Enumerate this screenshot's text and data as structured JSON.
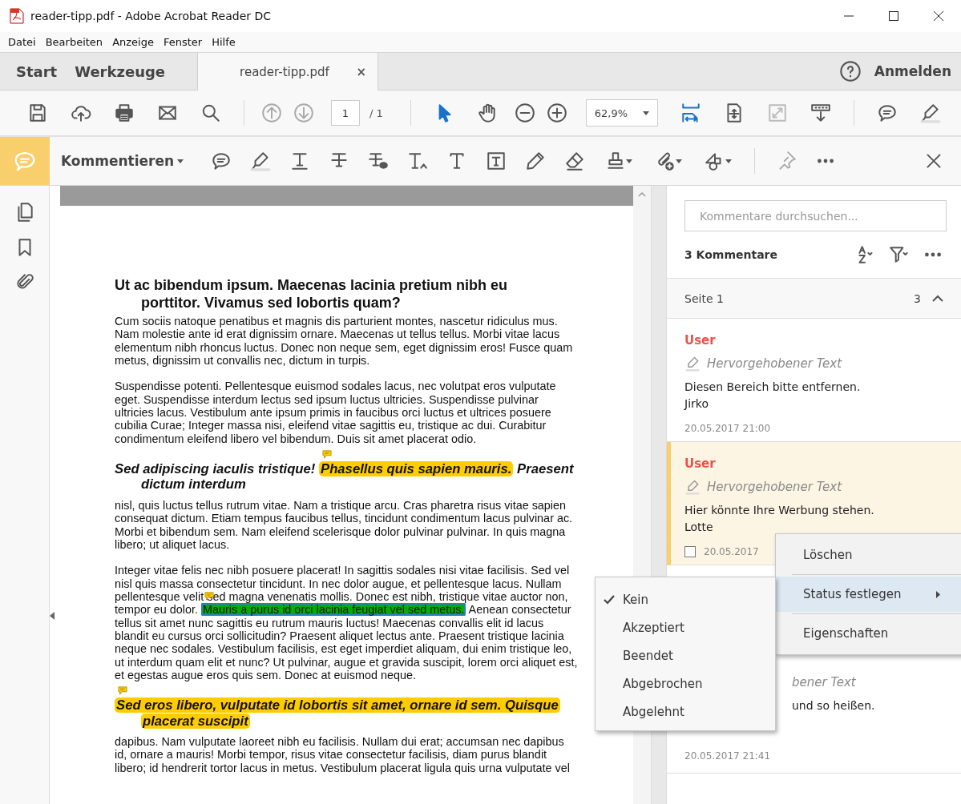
{
  "window": {
    "title": "reader-tipp.pdf - Adobe Acrobat Reader DC"
  },
  "menu": [
    "Datei",
    "Bearbeiten",
    "Anzeige",
    "Fenster",
    "Hilfe"
  ],
  "tabs": [
    {
      "label": "Start",
      "selected": false
    },
    {
      "label": "Werkzeuge",
      "selected": false
    },
    {
      "label": "reader-tipp.pdf",
      "selected": true,
      "close": "×"
    }
  ],
  "sign_in": "Anmelden",
  "toolbar": {
    "page": "1",
    "page_total": "/ 1",
    "zoom": "62,9%"
  },
  "comment_toolbar": {
    "title": "Kommentieren"
  },
  "document": {
    "blocks": [
      {
        "kind": "heading",
        "segments": [
          {
            "text": "Ut ac bibendum ipsum. Maecenas lacinia pretium nibh eu porttitor. Vivamus sed lobortis quam?",
            "highlight": false
          }
        ]
      },
      {
        "kind": "paragraph",
        "segments": [
          {
            "text": "Cum sociis natoque penatibus et magnis dis parturient montes, nascetur ridiculus mus. Nam molestie ante id erat dignissim ornare. Maecenas ut tellus tellus. Morbi vitae lacus elementum nibh rhoncus luctus. Donec non neque sem, eget dignissim eros! Fusce quam metus, dignissim ut convallis nec, dictum in turpis.",
            "highlight": false
          }
        ]
      },
      {
        "kind": "paragraph",
        "segments": [
          {
            "text": "Suspendisse potenti. Pellentesque euismod sodales lacus, nec volutpat eros vulputate eget. Suspendisse interdum lectus sed ipsum luctus ultricies. Suspendisse pulvinar ultricies lacus. Vestibulum ante ipsum primis in faucibus orci luctus et ultrices posuere cubilia Curae; Integer massa nisi, eleifend vitae sagittis eu, tristique ac dui. Curabitur condimentum eleifend libero vel bibendum. Duis sit amet placerat odio.",
            "highlight": false
          }
        ]
      },
      {
        "kind": "subheading",
        "segments": [
          {
            "text": "Sed adipiscing iaculis tristique! ",
            "highlight": false
          },
          {
            "text": "Phasellus quis sapien mauris.",
            "highlight": true,
            "color": "#ffcc00",
            "selected": false,
            "note": true
          },
          {
            "text": " Praesent dictum interdum",
            "highlight": false
          }
        ]
      },
      {
        "kind": "paragraph",
        "segments": [
          {
            "text": "nisl, quis luctus tellus rutrum vitae. Nam a tristique arcu. Cras pharetra risus vitae sapien consequat dictum. Etiam tempus faucibus tellus, tincidunt condimentum lacus pulvinar ac. Morbi et bibendum sem. Nam eleifend scelerisque dolor pulvinar pulvinar. In quis magna libero; ut aliquet lacus.",
            "highlight": false
          }
        ]
      },
      {
        "kind": "paragraph",
        "segments": [
          {
            "text": "Integer vitae felis nec nibh posuere placerat! In sagittis sodales nisi vitae facilisis. Sed vel nisl quis massa consectetur tincidunt. In nec dolor augue, et pellentesque lacus. Nullam pellentesque velit sed magna venenatis mollis. Donec est nibh, tristique vitae auctor non, tempor eu dolor. ",
            "highlight": false
          },
          {
            "text": "Mauris a purus id orci lacinia feugiat vel sed metus.",
            "highlight": true,
            "color": "#00b000",
            "selected": true,
            "note": true
          },
          {
            "text": " Aenean consectetur tellus sit amet nunc sagittis eu rutrum mauris luctus! Maecenas convallis elit id lacus blandit eu cursus orci sollicitudin? Praesent aliquet lectus ante. Praesent tristique lacinia neque nec sodales. Vestibulum facilisis, est eget imperdiet aliquam, dui enim tristique leo, ut interdum quam elit et nunc? Ut pulvinar, augue et gravida suscipit, lorem orci aliquet est, et egestas augue eros quis sem. Donec at euismod neque.",
            "highlight": false
          }
        ]
      },
      {
        "kind": "subheading",
        "segments": [
          {
            "text": "Sed eros libero, vulputate id lobortis sit amet, ornare id sem. Quisque placerat suscipit",
            "highlight": true,
            "color": "#ffcc00",
            "selected": false,
            "note": true
          }
        ]
      },
      {
        "kind": "paragraph",
        "segments": [
          {
            "text": "dapibus. Nam vulputate laoreet nibh eu facilisis. Nullam dui erat; accumsan nec dapibus id, ornare a mauris! Morbi tempor, risus vitae consectetur facilisis, diam purus blandit libero; id hendrerit tortor lacus in metus. Vestibulum placerat ligula quis urna vulputate vel",
            "highlight": false
          }
        ]
      }
    ]
  },
  "comments_panel": {
    "search": {
      "placeholder": "Kommentare durchsuchen..."
    },
    "count": "3 Kommentare",
    "page_group": {
      "label": "Seite 1",
      "count": "3",
      "expanded": true
    },
    "comments": [
      {
        "kind": "full",
        "author": "User",
        "type": "Hervorgehobener Text",
        "lines": [
          "Diesen Bereich bitte entfernen.",
          "Jirko"
        ],
        "date": "20.05.2017  21:00",
        "selected": false
      },
      {
        "kind": "full",
        "author": "User",
        "type": "Hervorgehobener Text",
        "lines": [
          "Hier könnte Ihre Werbung stehen.",
          "Lotte"
        ],
        "date": "20.05.2017",
        "selected": true,
        "checked": false
      },
      {
        "kind": "covered",
        "type": "bener Text",
        "lines": [
          "und so heißen."
        ],
        "date": "20.05.2017  21:41",
        "selected": false
      }
    ]
  },
  "context_menu": {
    "items": [
      {
        "label": "Löschen",
        "selected": false,
        "submenu": false
      },
      {
        "label": "Status festlegen",
        "selected": true,
        "submenu": true
      },
      {
        "label": "Eigenschaften",
        "selected": false,
        "submenu": false
      }
    ]
  },
  "status_menu": {
    "items": [
      {
        "label": "Kein",
        "checked": true
      },
      {
        "label": "Akzeptiert",
        "checked": false
      },
      {
        "label": "Beendet",
        "checked": false
      },
      {
        "label": "Abgebrochen",
        "checked": false
      },
      {
        "label": "Abgelehnt",
        "checked": false
      }
    ]
  }
}
